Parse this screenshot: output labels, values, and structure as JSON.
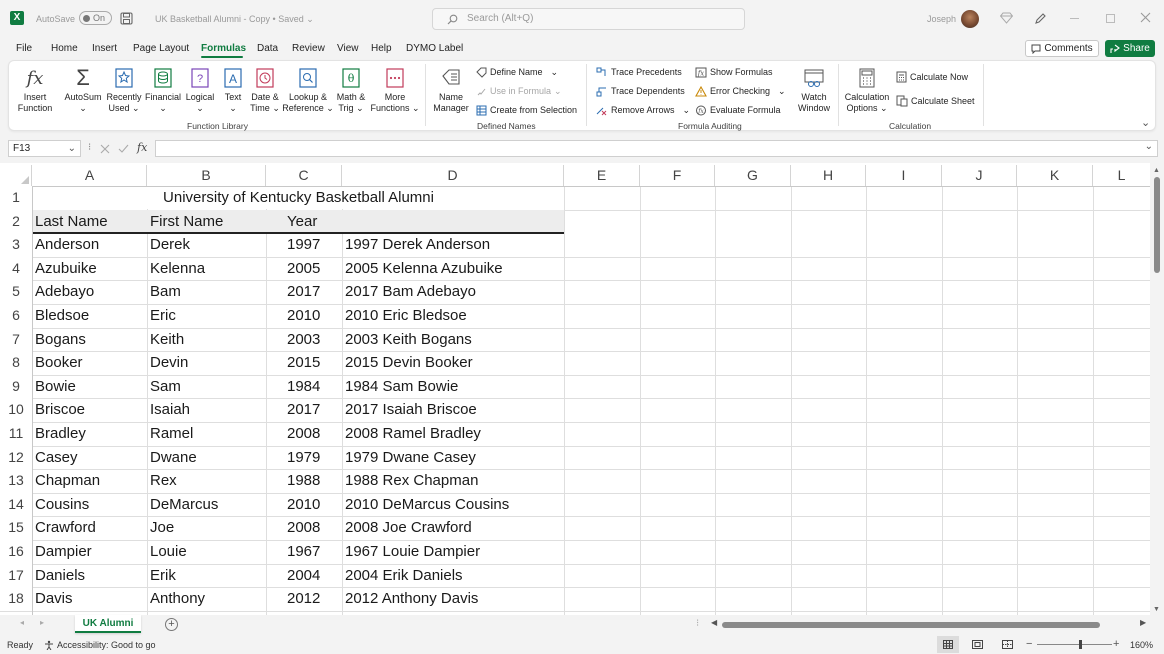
{
  "titlebar": {
    "autosave": "AutoSave",
    "toggle": "On",
    "doc_title": "UK Basketball Alumni - Copy • Saved",
    "search_placeholder": "Search (Alt+Q)",
    "user": "Joseph"
  },
  "menu": [
    "File",
    "Home",
    "Insert",
    "Page Layout",
    "Formulas",
    "Data",
    "Review",
    "View",
    "Help",
    "DYMO Label"
  ],
  "menu_active": "Formulas",
  "buttons": {
    "comments": "Comments",
    "share": "Share"
  },
  "ribbon": {
    "function_library": {
      "label": "Function Library",
      "items": [
        {
          "l1": "Insert",
          "l2": "Function",
          "icon": "insert-function-icon"
        },
        {
          "l1": "AutoSum",
          "l2": "",
          "icon": "autosum-icon"
        },
        {
          "l1": "Recently",
          "l2": "Used",
          "icon": "recently-used-icon"
        },
        {
          "l1": "Financial",
          "l2": "",
          "icon": "financial-icon"
        },
        {
          "l1": "Logical",
          "l2": "",
          "icon": "logical-icon"
        },
        {
          "l1": "Text",
          "l2": "",
          "icon": "text-icon"
        },
        {
          "l1": "Date &",
          "l2": "Time",
          "icon": "date-time-icon"
        },
        {
          "l1": "Lookup &",
          "l2": "Reference",
          "icon": "lookup-reference-icon"
        },
        {
          "l1": "Math &",
          "l2": "Trig",
          "icon": "math-trig-icon"
        },
        {
          "l1": "More",
          "l2": "Functions",
          "icon": "more-functions-icon"
        }
      ]
    },
    "defined_names": {
      "label": "Defined Names",
      "name_manager_1": "Name",
      "name_manager_2": "Manager",
      "define_name": "Define Name",
      "use_in_formula": "Use in Formula",
      "create_from_selection": "Create from Selection"
    },
    "formula_auditing": {
      "label": "Formula Auditing",
      "trace_precedents": "Trace Precedents",
      "trace_dependents": "Trace Dependents",
      "remove_arrows": "Remove Arrows",
      "show_formulas": "Show Formulas",
      "error_checking": "Error Checking",
      "evaluate_formula": "Evaluate Formula",
      "watch_1": "Watch",
      "watch_2": "Window"
    },
    "calculation": {
      "label": "Calculation",
      "options_1": "Calculation",
      "options_2": "Options",
      "calc_now": "Calculate Now",
      "calc_sheet": "Calculate Sheet"
    }
  },
  "namebox": "F13",
  "fx": "fx",
  "columns": [
    "A",
    "B",
    "C",
    "D",
    "E",
    "F",
    "G",
    "H",
    "I",
    "J",
    "K",
    "L"
  ],
  "title_cell": "University of Kentucky Basketball Alumni",
  "headers": {
    "a": "Last Name",
    "b": "First Name",
    "c": "Year",
    "d": ""
  },
  "rows": [
    {
      "n": "3",
      "last": "Anderson",
      "first": "Derek",
      "year": "1997",
      "combo": "1997 Derek Anderson"
    },
    {
      "n": "4",
      "last": "Azubuike",
      "first": "Kelenna",
      "year": "2005",
      "combo": "2005 Kelenna Azubuike"
    },
    {
      "n": "5",
      "last": "Adebayo",
      "first": "Bam",
      "year": "2017",
      "combo": "2017 Bam Adebayo"
    },
    {
      "n": "6",
      "last": "Bledsoe",
      "first": "Eric",
      "year": "2010",
      "combo": "2010 Eric Bledsoe"
    },
    {
      "n": "7",
      "last": "Bogans",
      "first": "Keith",
      "year": "2003",
      "combo": "2003 Keith Bogans"
    },
    {
      "n": "8",
      "last": "Booker",
      "first": "Devin",
      "year": "2015",
      "combo": "2015 Devin Booker"
    },
    {
      "n": "9",
      "last": "Bowie",
      "first": "Sam",
      "year": "1984",
      "combo": "1984 Sam Bowie"
    },
    {
      "n": "10",
      "last": "Briscoe",
      "first": "Isaiah",
      "year": "2017",
      "combo": "2017 Isaiah Briscoe"
    },
    {
      "n": "11",
      "last": "Bradley",
      "first": "Ramel",
      "year": "2008",
      "combo": "2008 Ramel Bradley"
    },
    {
      "n": "12",
      "last": "Casey",
      "first": "Dwane",
      "year": "1979",
      "combo": "1979 Dwane Casey"
    },
    {
      "n": "13",
      "last": "Chapman",
      "first": "Rex",
      "year": "1988",
      "combo": "1988 Rex Chapman"
    },
    {
      "n": "14",
      "last": "Cousins",
      "first": "DeMarcus",
      "year": "2010",
      "combo": "2010 DeMarcus Cousins"
    },
    {
      "n": "15",
      "last": "Crawford",
      "first": "Joe",
      "year": "2008",
      "combo": "2008 Joe Crawford"
    },
    {
      "n": "16",
      "last": "Dampier",
      "first": "Louie",
      "year": "1967",
      "combo": "1967 Louie Dampier"
    },
    {
      "n": "17",
      "last": "Daniels",
      "first": "Erik",
      "year": "2004",
      "combo": "2004 Erik Daniels"
    },
    {
      "n": "18",
      "last": "Davis",
      "first": "Anthony",
      "year": "2012",
      "combo": "2012 Anthony Davis"
    }
  ],
  "sheet_tab": "UK Alumni",
  "status": {
    "ready": "Ready",
    "accessibility": "Accessibility: Good to go",
    "zoom": "160%"
  },
  "colors": {
    "accent": "#107c41"
  }
}
